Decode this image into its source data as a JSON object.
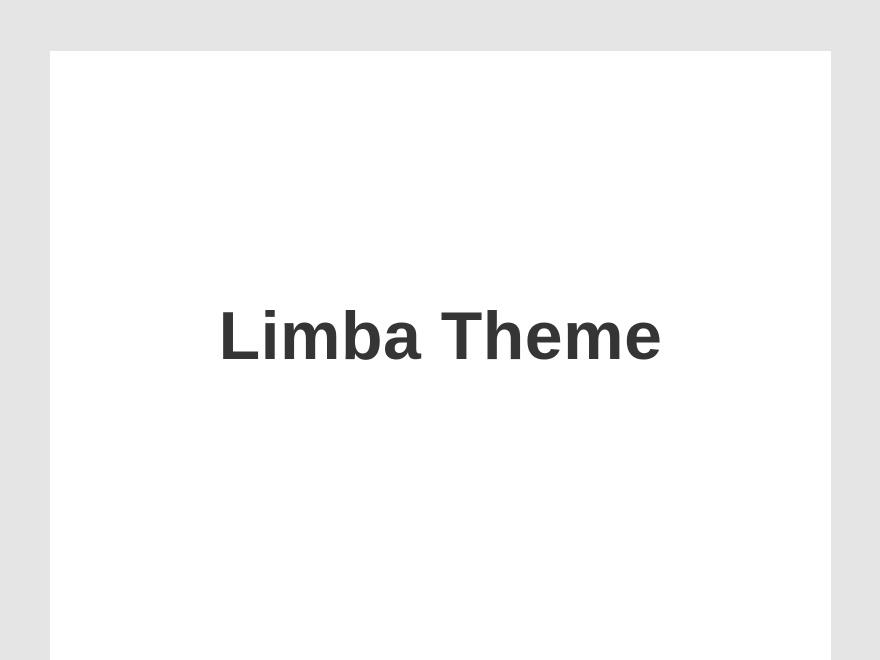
{
  "theme_card": {
    "title": "Limba Theme"
  },
  "colors": {
    "background": "#e5e5e5",
    "card": "#ffffff",
    "title_text": "#353535"
  }
}
